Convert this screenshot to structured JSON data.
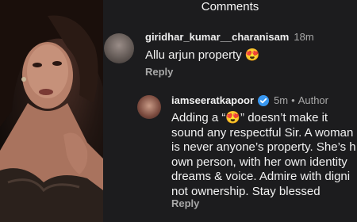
{
  "header": {
    "title": "Comments"
  },
  "comments": [
    {
      "username": "giridhar_kumar__charanisam",
      "time": "18m",
      "lines": [
        "Allu arjun property 😍"
      ],
      "reply_label": "Reply"
    },
    {
      "username": "iamseeratkapoor",
      "verified": true,
      "time": "5m",
      "separator": "•",
      "badge": "Author",
      "lines": [
        "Adding a “😍” doesn’t make it",
        "sound any respectful Sir. A woman",
        "is never anyone’s property. She’s h",
        "own person, with her own identity",
        "dreams & voice. Admire with digni",
        "not ownership. Stay blessed"
      ],
      "reply_label": "Reply"
    }
  ],
  "colors": {
    "panel_bg": "#1c1c1e",
    "muted": "#a8a8a8",
    "verified": "#3897f0"
  }
}
